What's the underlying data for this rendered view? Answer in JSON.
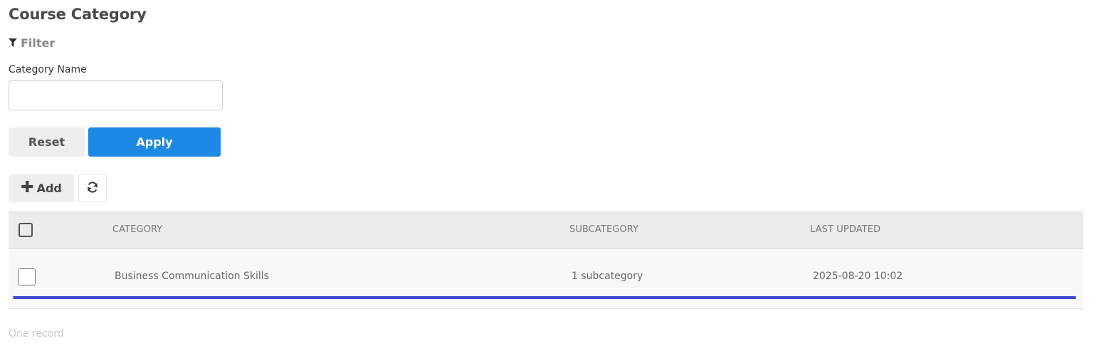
{
  "page": {
    "title": "Course Category"
  },
  "filter": {
    "toggle_label": "Filter",
    "category_name_label": "Category Name",
    "category_name_value": "",
    "category_name_placeholder": "",
    "reset_label": "Reset",
    "apply_label": "Apply"
  },
  "toolbar": {
    "add_label": "Add",
    "refresh_icon": "refresh-icon"
  },
  "table": {
    "columns": [
      "CATEGORY",
      "SUBCATEGORY",
      "LAST UPDATED"
    ],
    "rows": [
      {
        "category": "Business Communication Skills",
        "subcategory": "1 subcategory",
        "last_updated": "2025-08-20 10:02"
      }
    ]
  },
  "footer": {
    "record_count": "One record"
  },
  "colors": {
    "primary": "#1e88e5",
    "row_highlight": "#3f48cc",
    "header_bg": "#ececec"
  }
}
